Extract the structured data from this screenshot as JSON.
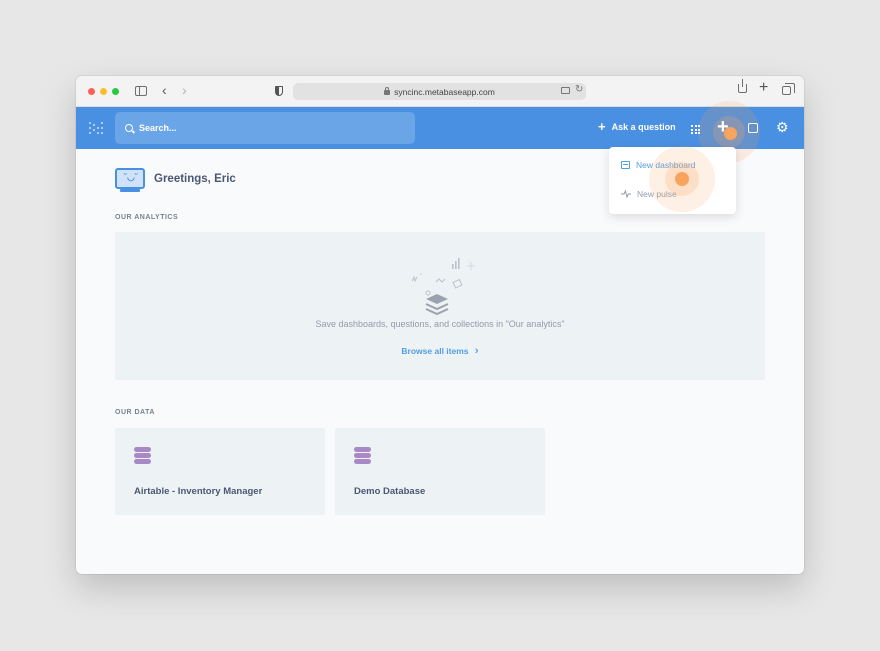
{
  "browser": {
    "url": "syncinc.metabaseapp.com"
  },
  "navbar": {
    "search_placeholder": "Search...",
    "ask_question_label": "Ask a question",
    "colors": {
      "nav_bg": "#4a90e2",
      "accent": "#509ee3",
      "highlight": "#f9a45e"
    }
  },
  "new_menu": {
    "items": [
      {
        "label": "New dashboard",
        "icon": "dashboard-icon"
      },
      {
        "label": "New pulse",
        "icon": "pulse-icon"
      }
    ]
  },
  "home": {
    "greeting": "Greetings, Eric",
    "analytics_section_label": "OUR ANALYTICS",
    "empty_state_text": "Save dashboards, questions, and collections in \"Our analytics\"",
    "browse_link_label": "Browse all items",
    "data_section_label": "OUR DATA",
    "databases": [
      {
        "name": "Airtable - Inventory Manager",
        "icon": "database-icon"
      },
      {
        "name": "Demo Database",
        "icon": "database-icon"
      }
    ]
  }
}
